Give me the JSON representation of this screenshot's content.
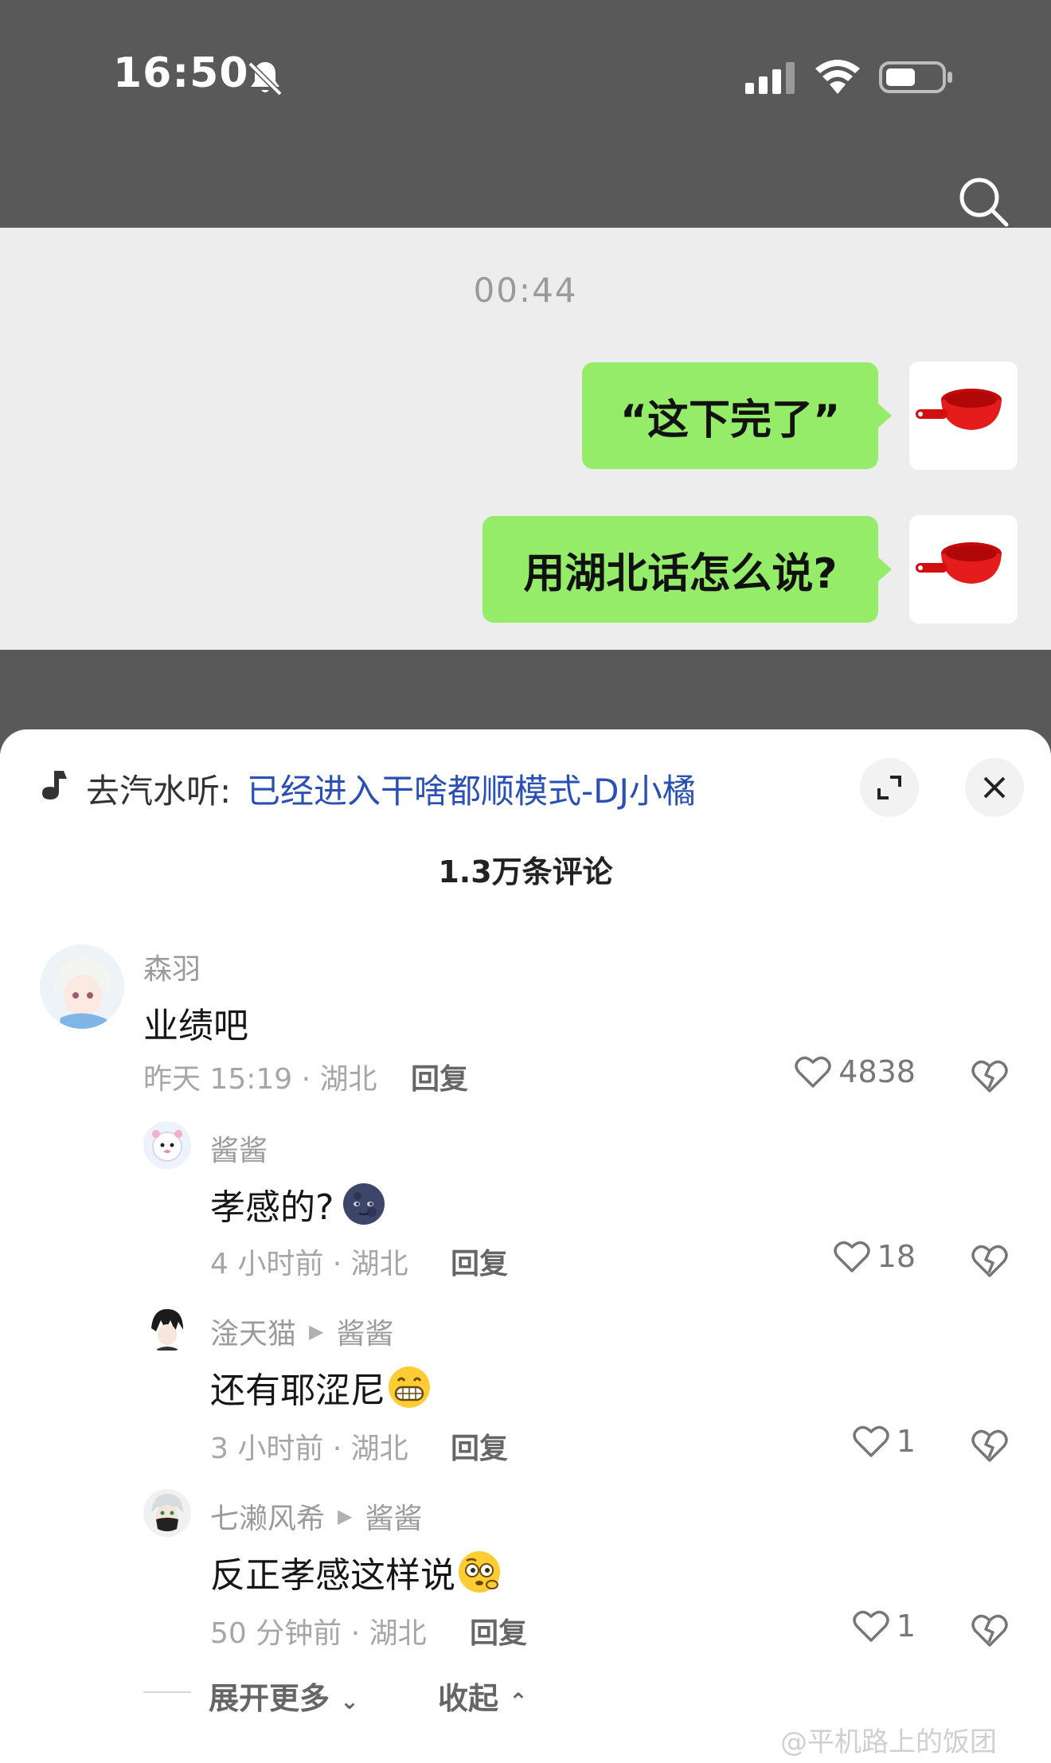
{
  "status": {
    "time": "16:50"
  },
  "chat": {
    "timestamp": "00:44",
    "messages": [
      {
        "text": "“这下完了”"
      },
      {
        "text": "用湖北话怎么说?"
      }
    ]
  },
  "sheet": {
    "music_prefix": "去汽水听:",
    "music_title": "已经进入干啥都顺模式-DJ小橘",
    "comment_count": "1.3万条评论",
    "comments": [
      {
        "name": "森羽",
        "text": "业绩吧",
        "meta": "昨天 15:19 · 湖北",
        "reply": "回复",
        "likes": "4838"
      },
      {
        "name": "酱酱",
        "text": "孝感的?",
        "meta": "4 小时前 · 湖北",
        "reply": "回复",
        "likes": "18"
      },
      {
        "name": "淦天猫",
        "reply_to": "酱酱",
        "text": "还有耶涩尼",
        "meta": "3 小时前 · 湖北",
        "reply": "回复",
        "likes": "1"
      },
      {
        "name": "七濑风希",
        "reply_to": "酱酱",
        "text": "反正孝感这样说",
        "meta": "50 分钟前 · 湖北",
        "reply": "回复",
        "likes": "1"
      }
    ],
    "expand_more": "展开更多",
    "collapse": "收起"
  },
  "watermark": "@平机路上的饭团",
  "icons": [
    "mute-icon",
    "signal-icon",
    "wifi-icon",
    "battery-icon",
    "search-icon",
    "ladle-icon",
    "music-icon",
    "expand-icon",
    "close-icon",
    "heart-icon",
    "dislike-icon"
  ],
  "colors": {
    "bubble": "#95ec69",
    "link": "#2a4fb5",
    "topbar": "#595959"
  }
}
